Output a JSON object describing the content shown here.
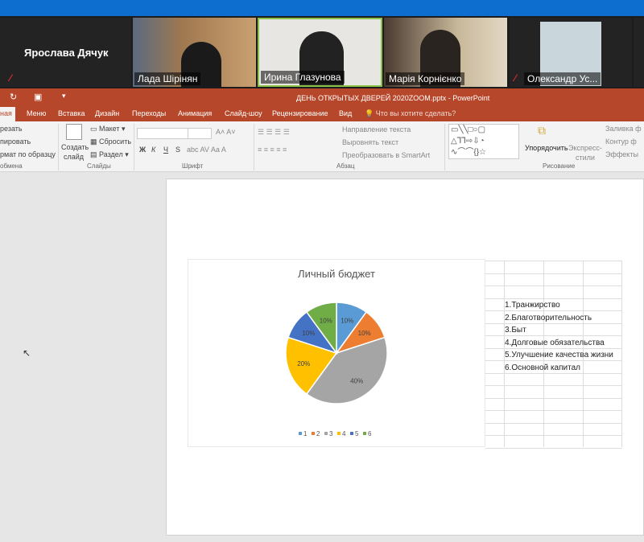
{
  "meeting": {
    "participants": [
      {
        "name": "Ярослава Дячук",
        "muted": true
      },
      {
        "name": "Лада Шірінян"
      },
      {
        "name": "Ирина Глазунова",
        "active_speaker": true
      },
      {
        "name": "Марія Корнієнко"
      },
      {
        "name": "Олександр Ус...",
        "muted": true
      }
    ]
  },
  "ppt": {
    "window_title": "ДЕНЬ ОТКРЫТЫХ ДВЕРЕЙ  2020ZOOM.pptx - PowerPoint",
    "tabs": [
      "ная",
      "Меню",
      "Вставка",
      "Дизайн",
      "Переходы",
      "Анимация",
      "Слайд-шоу",
      "Рецензирование",
      "Вид"
    ],
    "tell_me": "Что вы хотите сделать?",
    "clipboard": {
      "cut": "резать",
      "copy": "пировать",
      "format": "рмат по образцу",
      "group": "обмена"
    },
    "slides": {
      "new1": "Создать",
      "new2": "слайд",
      "layout": "Макет",
      "reset": "Сбросить",
      "section": "Раздел",
      "group": "Слайды"
    },
    "font": {
      "group": "Шрифт",
      "bold": "Ж",
      "italic": "К",
      "underline": "Ч",
      "strike": "S"
    },
    "paragraph": {
      "dir": "Направление текста",
      "align": "Выровнять текст",
      "smartart": "Преобразовать в SmartArt",
      "group": "Абзац"
    },
    "drawing": {
      "arrange": "Упорядочить",
      "styles1": "Экспресс-",
      "styles2": "стили",
      "fill": "Заливка ф",
      "outline": "Контур ф",
      "effects": "Эффекты",
      "group": "Рисование"
    }
  },
  "chart_data": {
    "type": "pie",
    "title": "Личный бюджет",
    "categories": [
      "1",
      "2",
      "3",
      "4",
      "5",
      "6"
    ],
    "values": [
      10,
      10,
      40,
      20,
      10,
      10
    ],
    "labels": [
      "10%",
      "10%",
      "40%",
      "20%",
      "10%",
      "10%"
    ],
    "colors": [
      "#5b9bd5",
      "#ed7d31",
      "#a5a5a5",
      "#ffc000",
      "#4472c4",
      "#70ad47"
    ],
    "legend": "bottom"
  },
  "legend_table": [
    "1.Транжирство",
    "2.Благотворительность",
    "3.Быт",
    "4.Долговые обязательства",
    "5.Улучшение качества жизни",
    "6.Основной капитал"
  ]
}
